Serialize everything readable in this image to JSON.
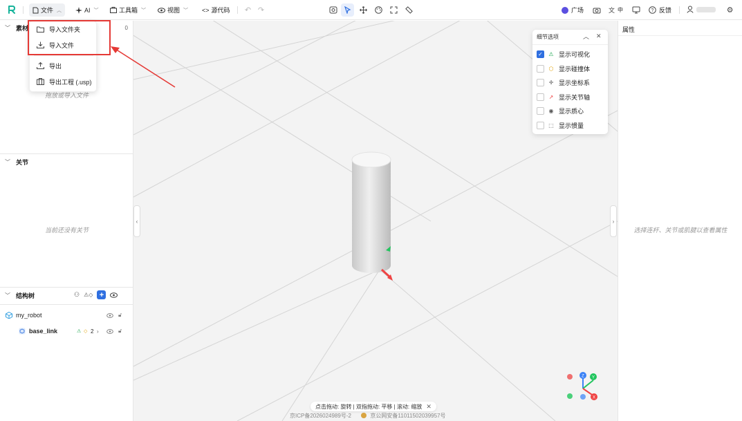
{
  "topbar": {
    "menus": {
      "file": "文件",
      "ai": "AI",
      "toolbox": "工具箱",
      "view": "视图",
      "source": "源代码"
    },
    "right": {
      "square": "广场",
      "lang": "中",
      "feedback": "反馈",
      "user": ""
    }
  },
  "file_menu": {
    "items": [
      "导入文件夹",
      "导入文件",
      "导出",
      "导出工程 (.usp)"
    ]
  },
  "left": {
    "assets": {
      "title": "素材",
      "count": "0",
      "empty": "拖放或导入文件"
    },
    "joints": {
      "title": "关节",
      "empty": "当前还没有关节"
    },
    "tree": {
      "title": "结构树",
      "root": "my_robot",
      "child": {
        "name": "base_link",
        "count": "2"
      }
    }
  },
  "right": {
    "title": "属性",
    "empty": "选择连杆、关节或肌腱以查看属性"
  },
  "detail_panel": {
    "title": "细节选项",
    "options": [
      {
        "label": "显示可视化",
        "checked": true
      },
      {
        "label": "显示碰撞体",
        "checked": false
      },
      {
        "label": "显示坐标系",
        "checked": false
      },
      {
        "label": "显示关节轴",
        "checked": false
      },
      {
        "label": "显示质心",
        "checked": false
      },
      {
        "label": "显示惯量",
        "checked": false
      }
    ]
  },
  "viewport": {
    "hint": "点击拖动: 旋转 | 双指拖动: 平移 | 滚动: 缩放",
    "icp1": "京ICP备2026024989号-2",
    "icp2": "京公网安备11011502039957号",
    "gizmo": {
      "z": "Z",
      "y": "Y",
      "x": "X"
    }
  },
  "colors": {
    "accent": "#2f6fe0",
    "highlight": "#e53935"
  }
}
